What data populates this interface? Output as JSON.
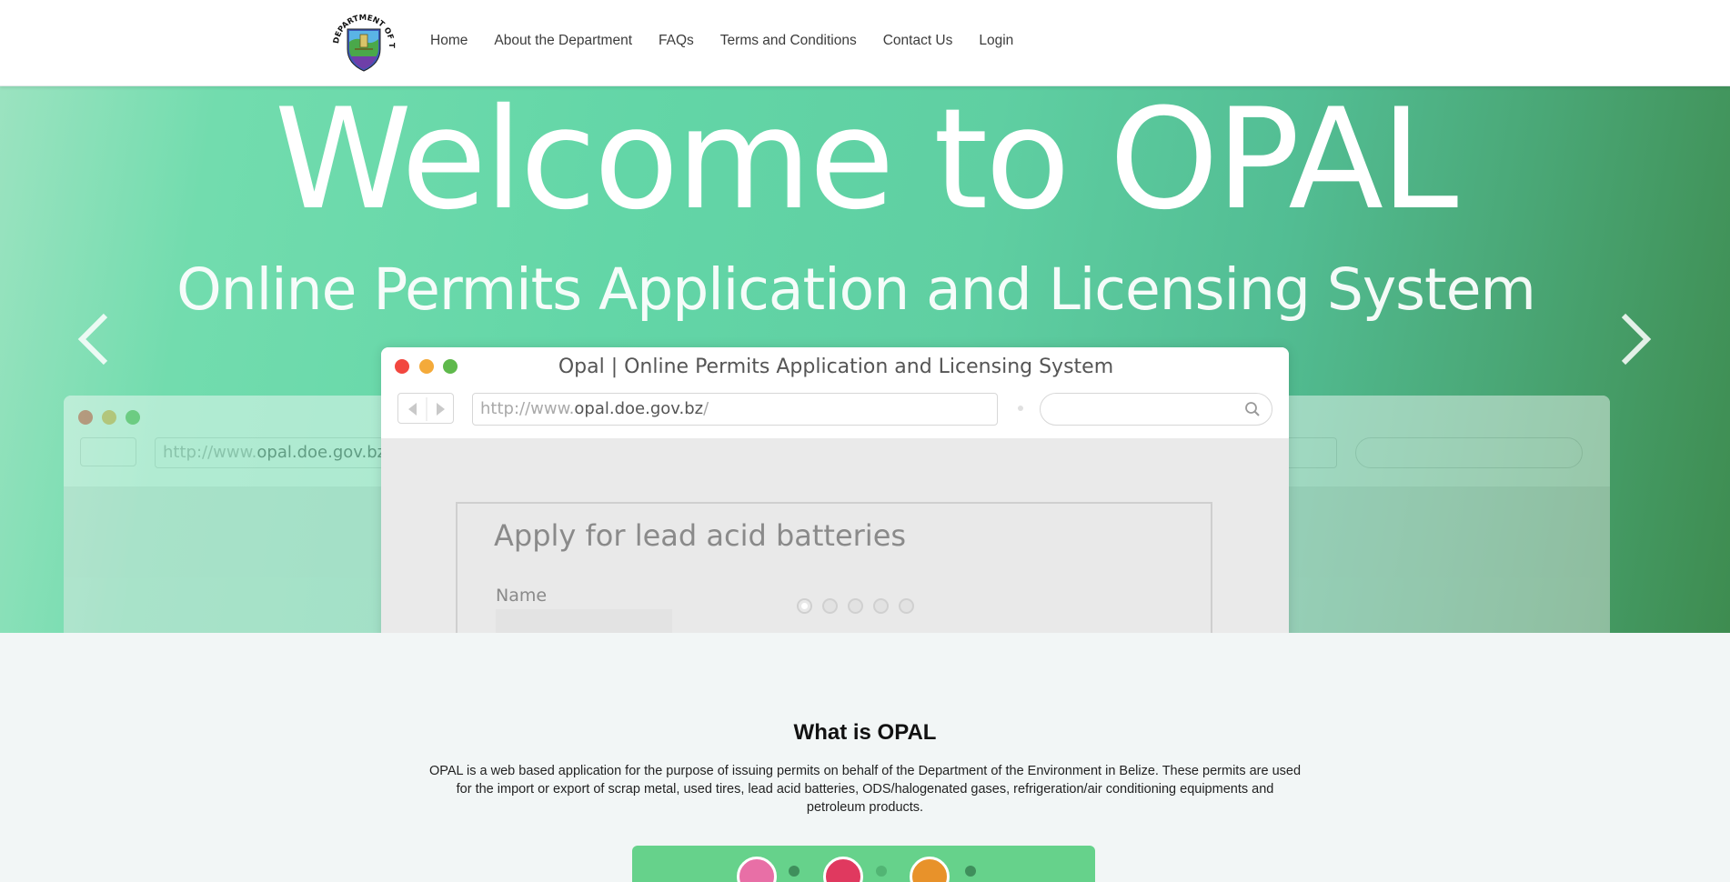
{
  "navbar": {
    "logo_text": "DEPARTMENT OF THE ENVIRONMENT",
    "links": [
      "Home",
      "About the Department",
      "FAQs",
      "Terms and Conditions",
      "Contact Us",
      "Login"
    ]
  },
  "hero": {
    "title": "Welcome to OPAL",
    "subtitle": "Online Permits Application and Licensing System",
    "window_title": "Opal | Online Permits Application and Licensing System",
    "url_prefix": "http://www.",
    "url_domain": "opal.doe.gov.bz",
    "url_suffix": "/",
    "back_url_prefix": "http://www.",
    "back_url_domain": "opal.doe.gov.bz",
    "form_heading": "Apply for lead acid batteries",
    "form_label": "Name",
    "slide_count": 5,
    "active_slide": 1
  },
  "about": {
    "title": "What is OPAL",
    "text": "OPAL is a web based application for the purpose of issuing permits on behalf of the Department of the Environment in Belize. These permits are used for the import or export of scrap metal, used tires, lead acid batteries, ODS/halogenated gases, refrigeration/air conditioning equipments and petroleum products."
  },
  "colors": {
    "hero_green": "#5fcfa2",
    "feature_green": "#66d28b",
    "close_dot": "#f2473f",
    "min_dot": "#f4aa3a",
    "max_dot": "#5fb94c"
  }
}
